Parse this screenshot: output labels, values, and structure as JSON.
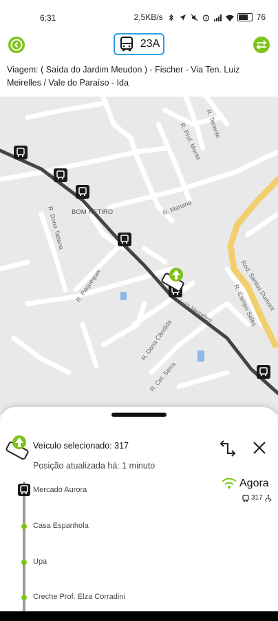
{
  "status_bar": {
    "time": "6:31",
    "network_speed": "2,5KB/s",
    "battery": "76"
  },
  "header": {
    "route_number": "23A",
    "trip_description": "Viagem: ( Saída do Jardim Meudon ) - Fischer - Via Ten. Luiz Meirelles / Vale do Paraíso - Ida"
  },
  "map": {
    "place_label": "BOM RETIRO",
    "streets": [
      "R. Tenente",
      "R. Prof. Monte",
      "R. Dona Tatiana",
      "R. Mariana",
      "Rod. Santos Dumont",
      "R. Paquequer",
      "R. Campo Sales",
      "R. Dona Cândida",
      "R. Cel. Serra",
      "Luiz Meirelles"
    ]
  },
  "bottom_sheet": {
    "vehicle_title": "Veículo selecionado: 317",
    "updated_text": "Posição atualizada há: 1 minuto",
    "arrival_label": "Agora",
    "arrival_vehicle": "317",
    "stops": [
      "Mercado Aurora",
      "Casa Espanhola",
      "Upa",
      "Creche Prof. Elza Corradini"
    ]
  },
  "colors": {
    "accent_green": "#7dc41a",
    "pill_blue": "#2ba0e0",
    "route_line": "#444444",
    "main_road": "#f2cf6e"
  }
}
